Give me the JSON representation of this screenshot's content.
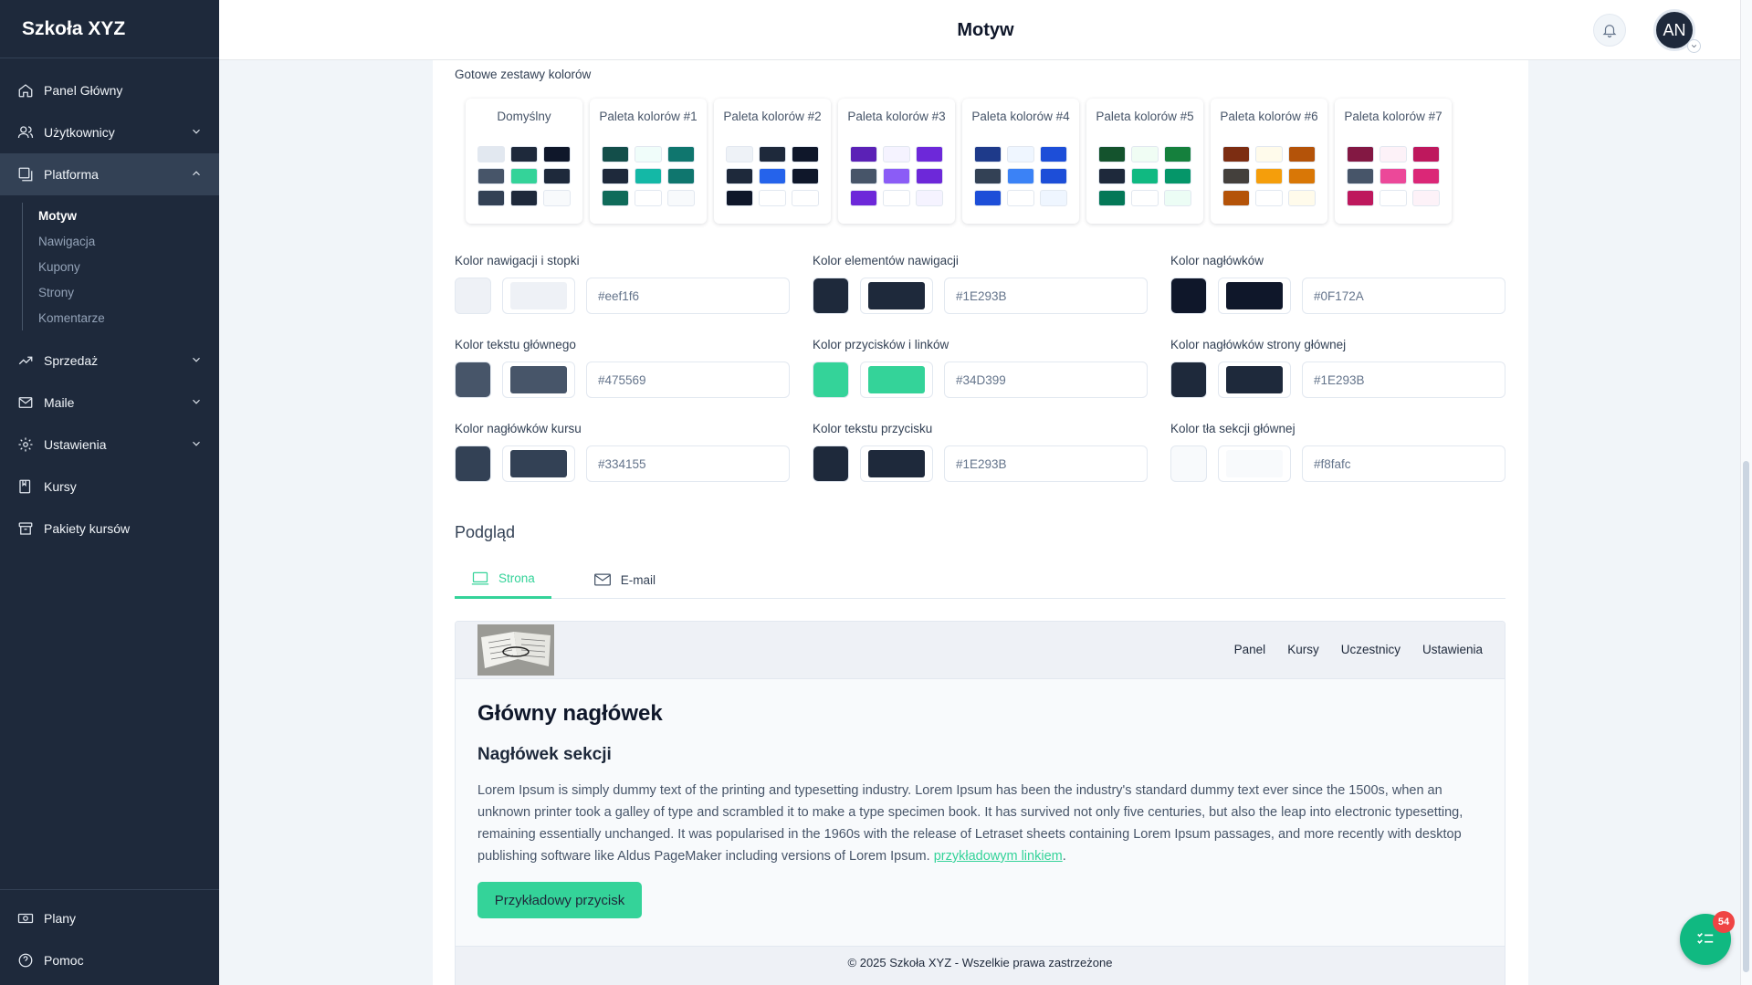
{
  "app": {
    "brand": "Szkoła XYZ"
  },
  "header": {
    "title": "Motyw",
    "avatar_initials": "AN"
  },
  "sidebar": {
    "items": [
      {
        "label": "Panel Główny"
      },
      {
        "label": "Użytkownicy"
      },
      {
        "label": "Platforma"
      },
      {
        "label": "Sprzedaż"
      },
      {
        "label": "Maile"
      },
      {
        "label": "Ustawienia"
      },
      {
        "label": "Kursy"
      },
      {
        "label": "Pakiety kursów"
      }
    ],
    "platform_sub": [
      {
        "label": "Motyw"
      },
      {
        "label": "Nawigacja"
      },
      {
        "label": "Kupony"
      },
      {
        "label": "Strony"
      },
      {
        "label": "Komentarze"
      }
    ],
    "bottom": [
      {
        "label": "Plany"
      },
      {
        "label": "Pomoc"
      }
    ]
  },
  "presets": {
    "title": "Gotowe zestawy kolorów",
    "palettes": [
      {
        "name": "Domyślny",
        "colors": [
          "#e2e8f0",
          "#1e293b",
          "#0f172a",
          "#475569",
          "#34d399",
          "#1e293b",
          "#334155",
          "#1e293b",
          "#f8fafc"
        ]
      },
      {
        "name": "Paleta kolorów #1",
        "colors": [
          "#134e4a",
          "#f0fdfa",
          "#0f766e",
          "#1e293b",
          "#14b8a6",
          "#0f766e",
          "#0f6b5a",
          "#ffffff",
          "#f8fafc"
        ]
      },
      {
        "name": "Paleta kolorów #2",
        "colors": [
          "#eef2f7",
          "#1e293b",
          "#0f172a",
          "#1e293b",
          "#2563eb",
          "#0f172a",
          "#0f172a",
          "#ffffff",
          "#ffffff"
        ]
      },
      {
        "name": "Paleta kolorów #3",
        "colors": [
          "#5b21b6",
          "#f5f3ff",
          "#6d28d9",
          "#475569",
          "#8b5cf6",
          "#6d28d9",
          "#6d28d9",
          "#ffffff",
          "#f5f3ff"
        ]
      },
      {
        "name": "Paleta kolorów #4",
        "colors": [
          "#1e3a8a",
          "#eff6ff",
          "#1d4ed8",
          "#334155",
          "#3b82f6",
          "#1d4ed8",
          "#1d4ed8",
          "#ffffff",
          "#eff6ff"
        ]
      },
      {
        "name": "Paleta kolorów #5",
        "colors": [
          "#14532d",
          "#f0fdf4",
          "#15803d",
          "#1e293b",
          "#10b981",
          "#059669",
          "#047857",
          "#ffffff",
          "#ecfdf5"
        ]
      },
      {
        "name": "Paleta kolorów #6",
        "colors": [
          "#7c2d12",
          "#fffbeb",
          "#b45309",
          "#44403c",
          "#f59e0b",
          "#d97706",
          "#b45309",
          "#ffffff",
          "#fffbeb"
        ]
      },
      {
        "name": "Paleta kolorów #7",
        "colors": [
          "#831843",
          "#fdf2f8",
          "#be185d",
          "#475569",
          "#ec4899",
          "#db2777",
          "#be185d",
          "#ffffff",
          "#fdf2f8"
        ]
      }
    ]
  },
  "colors": [
    {
      "label": "Kolor nawigacji i stopki",
      "value": "#eef1f6",
      "swatch": "#eef1f6"
    },
    {
      "label": "Kolor elementów nawigacji",
      "value": "#1E293B",
      "swatch": "#1e293b"
    },
    {
      "label": "Kolor nagłówków",
      "value": "#0F172A",
      "swatch": "#0f172a"
    },
    {
      "label": "Kolor tekstu głównego",
      "value": "#475569",
      "swatch": "#475569"
    },
    {
      "label": "Kolor przycisków i linków",
      "value": "#34D399",
      "swatch": "#34d399"
    },
    {
      "label": "Kolor nagłówków strony głównej",
      "value": "#1E293B",
      "swatch": "#1e293b"
    },
    {
      "label": "Kolor nagłówków kursu",
      "value": "#334155",
      "swatch": "#334155"
    },
    {
      "label": "Kolor tekstu przycisku",
      "value": "#1E293B",
      "swatch": "#1e293b"
    },
    {
      "label": "Kolor tła sekcji głównej",
      "value": "#f8fafc",
      "swatch": "#f8fafc"
    }
  ],
  "preview": {
    "title": "Podgląd",
    "tabs": [
      {
        "label": "Strona"
      },
      {
        "label": "E-mail"
      }
    ],
    "nav_links": [
      "Panel",
      "Kursy",
      "Uczestnicy",
      "Ustawienia"
    ],
    "h1": "Główny nagłówek",
    "h2": "Nagłówek sekcji",
    "paragraph": "Lorem Ipsum is simply dummy text of the printing and typesetting industry. Lorem Ipsum has been the industry's standard dummy text ever since the 1500s, when an unknown printer took a galley of type and scrambled it to make a type specimen book. It has survived not only five centuries, but also the leap into electronic typesetting, remaining essentially unchanged. It was popularised in the 1960s with the release of Letraset sheets containing Lorem Ipsum passages, and more recently with desktop publishing software like Aldus PageMaker including versions of Lorem Ipsum.",
    "link_text": "przykładowym linkiem",
    "link_suffix": ".",
    "button": "Przykładowy przycisk",
    "footer": "© 2025 Szkoła XYZ - Wszelkie prawa zastrzeżone"
  },
  "fab": {
    "badge": "54"
  }
}
